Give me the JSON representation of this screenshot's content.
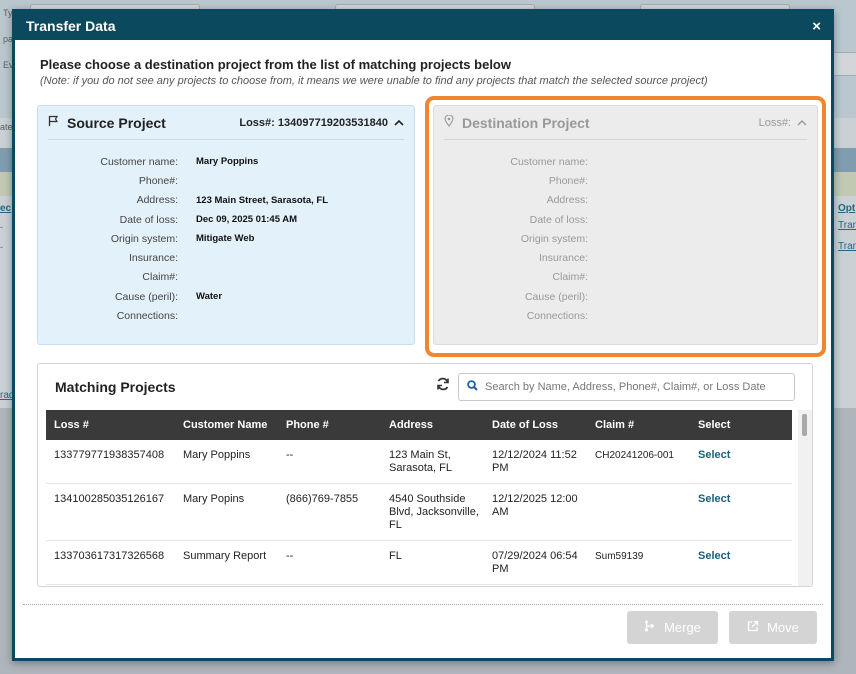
{
  "background": {
    "stubs": [
      "Ty",
      "pa",
      "Eve",
      "ate",
      "ec",
      "rad"
    ],
    "right_link": "Opt",
    "right_rows": [
      "Tran",
      "Tran"
    ]
  },
  "modal": {
    "title": "Transfer Data",
    "close": "×",
    "instruction": "Please choose a destination project from the list of matching projects below",
    "note": "(Note: if you do not see any projects to choose from, it means we were unable to find any projects that match the selected source project)"
  },
  "source": {
    "title": "Source Project",
    "loss": "Loss#: 134097719203531840",
    "icon": "flag-icon",
    "fields": [
      {
        "label": "Customer name:",
        "value": "Mary Poppins"
      },
      {
        "label": "Phone#:",
        "value": ""
      },
      {
        "label": "Address:",
        "value": "123 Main Street, Sarasota, FL"
      },
      {
        "label": "Date of loss:",
        "value": "Dec 09, 2025 01:45 AM"
      },
      {
        "label": "Origin system:",
        "value": "Mitigate Web"
      },
      {
        "label": "Insurance:",
        "value": ""
      },
      {
        "label": "Claim#:",
        "value": ""
      },
      {
        "label": "Cause (peril):",
        "value": "Water"
      },
      {
        "label": "Connections:",
        "value": ""
      }
    ]
  },
  "destination": {
    "title": "Destination Project",
    "loss": "Loss#:",
    "icon": "map-pin-icon",
    "highlight_color": "#f0862d",
    "fields": [
      {
        "label": "Customer name:"
      },
      {
        "label": "Phone#:"
      },
      {
        "label": "Address:"
      },
      {
        "label": "Date of loss:"
      },
      {
        "label": "Origin system:"
      },
      {
        "label": "Insurance:"
      },
      {
        "label": "Claim#:"
      },
      {
        "label": "Cause (peril):"
      },
      {
        "label": "Connections:"
      }
    ]
  },
  "matching": {
    "title": "Matching Projects",
    "search_placeholder": "Search by Name, Address, Phone#, Claim#, or Loss Date",
    "columns": [
      "Loss #",
      "Customer Name",
      "Phone #",
      "Address",
      "Date of Loss",
      "Claim #",
      "Select"
    ],
    "rows": [
      {
        "loss": "133779771938357408",
        "name": "Mary Poppins",
        "phone": "--",
        "address": "123 Main St, Sarasota, FL",
        "date": "12/12/2024 11:52 PM",
        "claim": "CH20241206-001",
        "select": "Select"
      },
      {
        "loss": "134100285035126167",
        "name": "Mary Popins",
        "phone": "(866)769-7855",
        "address": "4540 Southside Blvd, Jacksonville, FL",
        "date": "12/12/2025 12:00 AM",
        "claim": "",
        "select": "Select"
      },
      {
        "loss": "133703617317326568",
        "name": "Summary Report",
        "phone": "--",
        "address": "FL",
        "date": "07/29/2024 06:54 PM",
        "claim": "Sum59139",
        "select": "Select"
      }
    ]
  },
  "buttons": {
    "merge": "Merge",
    "move": "Move"
  }
}
